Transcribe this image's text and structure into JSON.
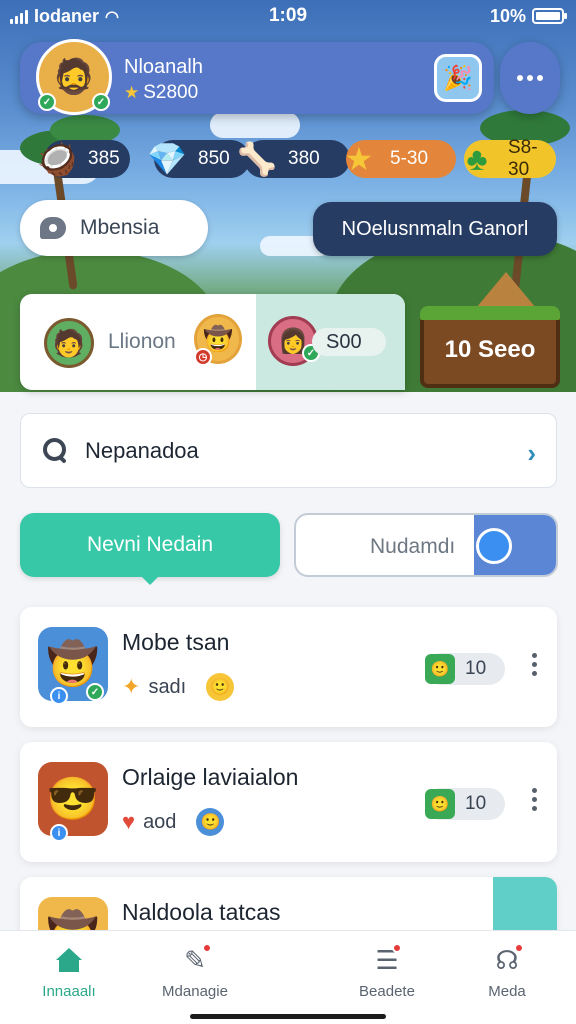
{
  "status_bar": {
    "carrier": "Iodaner",
    "time": "1:09",
    "battery": "10%"
  },
  "profile": {
    "name": "Nloanalh",
    "coins": "S2800",
    "emblem_icon": "party-hat-character",
    "more_icon": "more-icon"
  },
  "currencies": [
    {
      "icon": "coconut-icon",
      "value": "385",
      "bg": "#263c63"
    },
    {
      "icon": "gem-icon",
      "value": "850",
      "bg": "#263c63"
    },
    {
      "icon": "bone-icon",
      "value": "380",
      "bg": "#263c63"
    },
    {
      "icon": "star-icon",
      "value": "5-30",
      "bg": "#e3853a"
    },
    {
      "icon": "clover-icon",
      "value": "S8-30",
      "bg": "#f1c52a"
    }
  ],
  "region_label": "Mbensia",
  "create_button": "NOelusnmaln Ganorl",
  "matchup": {
    "player_name": "Llionon",
    "score": "S00"
  },
  "level_sign": "10 Seeo",
  "search": {
    "text": "Nepanadoa"
  },
  "toggle": {
    "active_label": "Nevni Nedain",
    "inactive_label": "Nudamdı"
  },
  "games": [
    {
      "title": "Mobe tsan",
      "meta": "sadı",
      "players": "10"
    },
    {
      "title": "Orlaige laviaialon",
      "meta": "aod",
      "players": "10"
    },
    {
      "title": "Naldoola tatcas"
    }
  ],
  "nav": [
    {
      "label": "Innaaalı",
      "active": true
    },
    {
      "label": "Mdanagie",
      "badge": true
    },
    {
      "label": "Beadete",
      "badge": true
    },
    {
      "label": "Meda",
      "badge": true
    }
  ],
  "colors": {
    "accent": "#37c8a7",
    "header": "#5778c9",
    "dark_button": "#263c63"
  }
}
